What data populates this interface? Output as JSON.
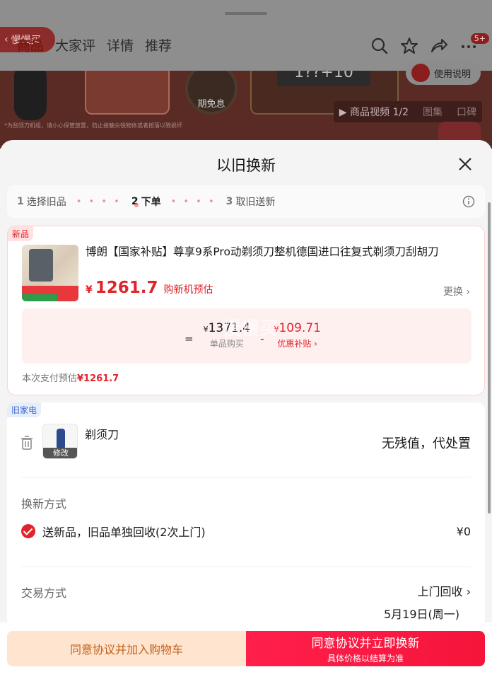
{
  "background_page": {
    "back_pill": "慢慢买",
    "tabs": [
      "商品",
      "大家评",
      "详情",
      "推荐"
    ],
    "active_tab": 0,
    "cart_badge": "5+",
    "usage_button": "使用说明",
    "banner_fine_print": "*为刮须刀机组，请小心保管放置，防止接触尖锐物体或者按落以致损坏",
    "banner_free_label": "期免息",
    "banner_screen": "1??+10",
    "media_bar": {
      "video": "▶ 商品视频 1/2",
      "gallery": "图集",
      "reputation": "口碑"
    }
  },
  "sheet": {
    "title": "以旧换新",
    "steps": [
      {
        "num": "1",
        "label": "选择旧品",
        "current": false
      },
      {
        "num": "2",
        "label": "下单",
        "current": true
      },
      {
        "num": "3",
        "label": "取旧送新",
        "current": false
      }
    ],
    "step_separator": "• • • •",
    "new_item": {
      "tag": "新品",
      "title": "博朗【国家补贴】尊享9系Pro动剃须刀整机德国进口往复式剃须刀刮胡刀",
      "price_currency": "¥",
      "price": "1261.7",
      "price_desc": "购新机预估",
      "swap_link": "更换 ›",
      "calc": {
        "equals": "=",
        "unit_price": "1371.4",
        "unit_price_label": "单品购买",
        "minus": "-",
        "subsidy": "109.71",
        "subsidy_label": "优惠补贴 ›",
        "currency": "¥"
      },
      "watermark": "慢慢买",
      "pay_estimate_label": "本次支付预估",
      "pay_estimate_value": "¥1261.7"
    },
    "old_item": {
      "tag": "旧家电",
      "name": "剃须刀",
      "edit_label": "修改",
      "value_text": "无残值，代处置"
    },
    "exchange_method": {
      "label": "换新方式",
      "option": "送新品，旧品单独回收(2次上门)",
      "amount": "¥0"
    },
    "trade_method": {
      "label": "交易方式",
      "value": "上门回收 ›",
      "date": "5月19日(周一)"
    },
    "footer": {
      "cart_button": "同意协议并加入购物车",
      "swap_button": "同意协议并立即换新",
      "swap_sub": "具体价格以结算为准"
    }
  }
}
